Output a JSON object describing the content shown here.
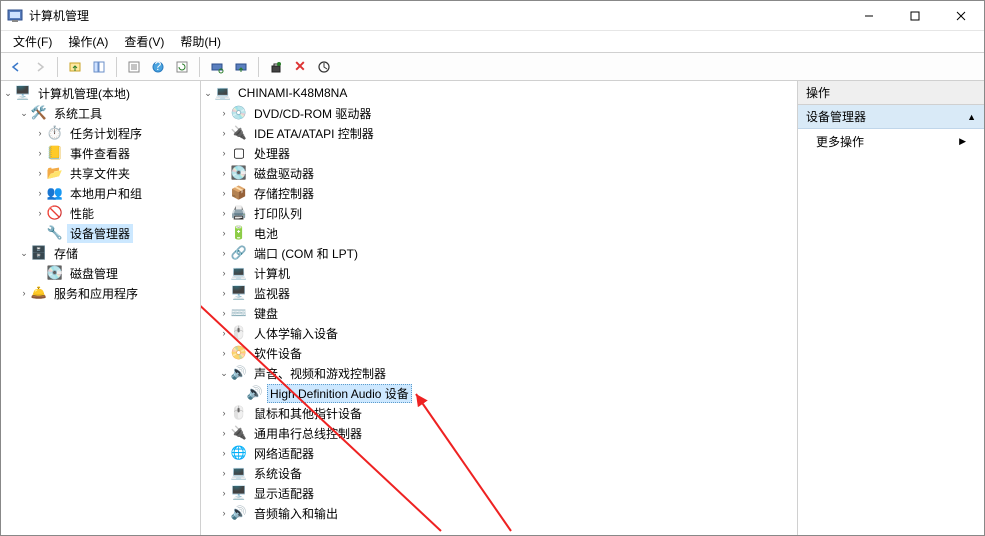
{
  "window": {
    "title": "计算机管理"
  },
  "menubar": [
    {
      "id": "file",
      "label": "文件(F)"
    },
    {
      "id": "action",
      "label": "操作(A)"
    },
    {
      "id": "view",
      "label": "查看(V)"
    },
    {
      "id": "help",
      "label": "帮助(H)"
    }
  ],
  "left_tree": {
    "root": {
      "label": "计算机管理(本地)",
      "icon": "🖥️",
      "expanded": true
    },
    "nodes": [
      {
        "label": "系统工具",
        "icon": "🛠️",
        "expanded": true,
        "depth": 1,
        "children": [
          {
            "label": "任务计划程序",
            "icon": "⏱️",
            "depth": 2,
            "expandable": true
          },
          {
            "label": "事件查看器",
            "icon": "📒",
            "depth": 2,
            "expandable": true
          },
          {
            "label": "共享文件夹",
            "icon": "📂",
            "depth": 2,
            "expandable": true
          },
          {
            "label": "本地用户和组",
            "icon": "👥",
            "depth": 2,
            "expandable": true
          },
          {
            "label": "性能",
            "icon": "🚫",
            "depth": 2,
            "expandable": true
          },
          {
            "label": "设备管理器",
            "icon": "🔧",
            "depth": 2,
            "selected": true
          }
        ]
      },
      {
        "label": "存储",
        "icon": "🗄️",
        "expanded": true,
        "depth": 1,
        "children": [
          {
            "label": "磁盘管理",
            "icon": "💽",
            "depth": 2
          }
        ]
      },
      {
        "label": "服务和应用程序",
        "icon": "🛎️",
        "depth": 1,
        "expandable": true
      }
    ]
  },
  "device_tree": {
    "computer_name": "CHINAMI-K48M8NA",
    "categories": [
      {
        "label": "DVD/CD-ROM 驱动器",
        "icon": "💿"
      },
      {
        "label": "IDE ATA/ATAPI 控制器",
        "icon": "🔌"
      },
      {
        "label": "处理器",
        "icon": "▢"
      },
      {
        "label": "磁盘驱动器",
        "icon": "💽"
      },
      {
        "label": "存储控制器",
        "icon": "📦"
      },
      {
        "label": "打印队列",
        "icon": "🖨️"
      },
      {
        "label": "电池",
        "icon": "🔋"
      },
      {
        "label": "端口 (COM 和 LPT)",
        "icon": "🔗"
      },
      {
        "label": "计算机",
        "icon": "💻"
      },
      {
        "label": "监视器",
        "icon": "🖥️"
      },
      {
        "label": "键盘",
        "icon": "⌨️"
      },
      {
        "label": "人体学输入设备",
        "icon": "🖱️"
      },
      {
        "label": "软件设备",
        "icon": "📀"
      },
      {
        "label": "声音、视频和游戏控制器",
        "icon": "🔊",
        "expanded": true,
        "children": [
          {
            "label": "High Definition Audio 设备",
            "icon": "🔊",
            "selected": true
          }
        ]
      },
      {
        "label": "鼠标和其他指针设备",
        "icon": "🖱️"
      },
      {
        "label": "通用串行总线控制器",
        "icon": "🔌"
      },
      {
        "label": "网络适配器",
        "icon": "🌐"
      },
      {
        "label": "系统设备",
        "icon": "💻"
      },
      {
        "label": "显示适配器",
        "icon": "🖥️"
      },
      {
        "label": "音频输入和输出",
        "icon": "🔊"
      }
    ]
  },
  "actions_pane": {
    "header": "操作",
    "section": "设备管理器",
    "more_actions": "更多操作"
  },
  "toolbar": {
    "back": "←",
    "forward": "→",
    "delete_label": "✕"
  }
}
